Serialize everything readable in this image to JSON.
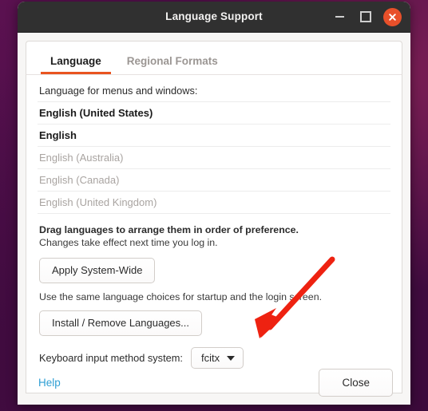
{
  "window": {
    "title": "Language Support",
    "controls": {
      "minimize": "minimize",
      "maximize": "maximize",
      "close": "close"
    }
  },
  "tabs": [
    {
      "label": "Language",
      "active": true
    },
    {
      "label": "Regional Formats",
      "active": false
    }
  ],
  "main": {
    "list_label": "Language for menus and windows:",
    "languages": [
      {
        "name": "English (United States)",
        "enabled": true
      },
      {
        "name": "English",
        "enabled": true
      },
      {
        "name": "English (Australia)",
        "enabled": false
      },
      {
        "name": "English (Canada)",
        "enabled": false
      },
      {
        "name": "English (United Kingdom)",
        "enabled": false
      }
    ],
    "hint_bold": "Drag languages to arrange them in order of preference.",
    "hint_normal": "Changes take effect next time you log in.",
    "apply_button": "Apply System-Wide",
    "apply_caption": "Use the same language choices for startup and the login screen.",
    "install_button": "Install / Remove Languages...",
    "ime_label": "Keyboard input method system:",
    "ime_value": "fcitx"
  },
  "footer": {
    "help_label": "Help",
    "close_label": "Close"
  },
  "annotation": {
    "type": "arrow",
    "color": "#ee2211",
    "points_to": "keyboard-input-method-dropdown"
  },
  "colors": {
    "accent": "#e95420",
    "titlebar": "#303030",
    "close_button": "#e8502a",
    "link": "#2f9fd4",
    "desktop": "#4d0f4b"
  }
}
